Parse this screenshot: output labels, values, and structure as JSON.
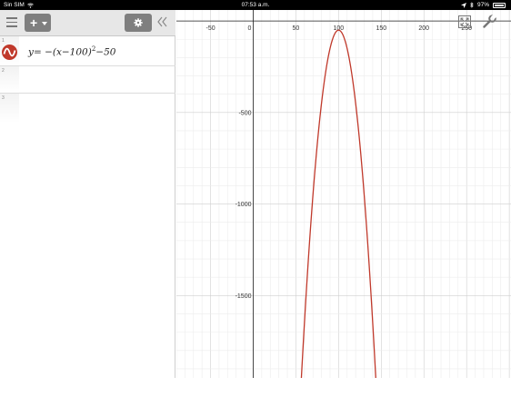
{
  "status_bar": {
    "carrier": "Sin SIM",
    "time": "07:53 a.m.",
    "battery": "97%",
    "battery_fraction": 0.97
  },
  "toolbar": {
    "menu_icon": "hamburger-menu-icon",
    "add_label": "+",
    "settings_icon": "gear-icon",
    "collapse_icon": "double-chevron-left-icon"
  },
  "expressions": [
    {
      "index": "1",
      "lhs": "y",
      "formula_main": "= −(x−100)",
      "exponent": "2",
      "formula_tail": "−50",
      "color": "#c0392b"
    },
    {
      "index": "2"
    },
    {
      "index": "3"
    }
  ],
  "graph_controls": {
    "zoom_fit_icon": "zoom-fit-icon",
    "wrench_icon": "wrench-icon"
  },
  "chart_data": {
    "type": "line",
    "title": "",
    "xlabel": "",
    "ylabel": "",
    "xlim": [
      -90,
      302
    ],
    "ylim": [
      -1950,
      60
    ],
    "x_ticks": [
      -50,
      0,
      50,
      100,
      150,
      200,
      250
    ],
    "y_ticks": [
      -500,
      -1000,
      -1500
    ],
    "x_tick_labels": [
      "-50",
      "0",
      "50",
      "100",
      "150",
      "200",
      "250"
    ],
    "y_tick_labels": [
      "-500",
      "-1000",
      "-1500"
    ],
    "grid": true,
    "series": [
      {
        "function": "-(x-100)^2-50",
        "color": "#c0392b",
        "x_range": [
          55,
          145
        ]
      }
    ]
  }
}
